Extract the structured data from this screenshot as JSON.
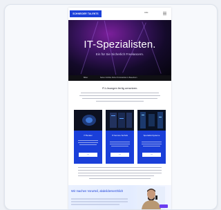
{
  "nav": {
    "logo_text": "SCHNEIDER TALENTS",
    "link_text": "Jobs",
    "menu_icon": "hamburger-menu-icon"
  },
  "hero": {
    "title": "IT-Spezialisten.",
    "subtitle": "Ein für Sie Sicherlich Freelancern."
  },
  "band": {
    "left": "Bilder",
    "right": "Sieben Schritte Sicher Ihr Entwickler in Bewerbern"
  },
  "section": {
    "title": "IT-Lösungen fertig umsetzen."
  },
  "tiles": [
    {
      "title": "IT Berater"
    },
    {
      "title": "IT-Service-Technik"
    },
    {
      "title": "Spezialist-Systeme"
    }
  ],
  "colors": {
    "accent": "#1a3fd9",
    "hero_dark": "#05040c",
    "promo_bg": "#eaf1ff"
  },
  "promo": {
    "title": "Wir machen Vorurteil, abdeilderseröhlich"
  }
}
